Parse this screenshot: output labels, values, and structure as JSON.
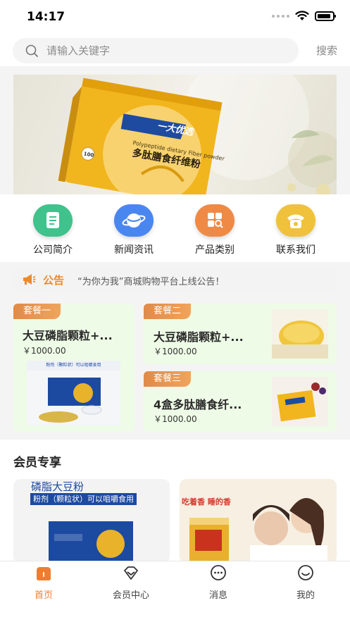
{
  "status_bar": {
    "time": "14:17"
  },
  "search": {
    "placeholder": "请输入关键字",
    "button_label": "搜索"
  },
  "banner": {
    "brand_text": "一大优选",
    "product_en": "Polypeptide dietary Fiber powder",
    "product_cn": "多肽膳食纤维粉",
    "badge": "100"
  },
  "nav": [
    {
      "label": "公司简介",
      "color": "#3fc28b",
      "icon": "document-icon"
    },
    {
      "label": "新闻资讯",
      "color": "#4a86f0",
      "icon": "planet-icon"
    },
    {
      "label": "产品类别",
      "color": "#ef8a46",
      "icon": "grid-search-icon"
    },
    {
      "label": "联系我们",
      "color": "#f0c13a",
      "icon": "phone-icon"
    }
  ],
  "notice": {
    "title": "公告",
    "text": "“为你为我”商城购物平台上线公告！"
  },
  "combos": [
    {
      "tag": "套餐一",
      "name": "大豆磷脂颗粒+...",
      "price": "￥1000.00",
      "image_caption": "粉剂（颗粒状）可以咀嚼食用"
    },
    {
      "tag": "套餐二",
      "name": "大豆磷脂颗粒+...",
      "price": "￥1000.00"
    },
    {
      "tag": "套餐三",
      "name": "4盒多肽膳食纤...",
      "price": "￥1000.00"
    }
  ],
  "member": {
    "title": "会员专享",
    "card1_title": "磷脂大豆粉",
    "card1_subtitle": "粉剂（颗粒状）可以咀嚼食用",
    "card2_slogan": "吃着香 睡的香"
  },
  "tabs": [
    {
      "label": "首页",
      "icon": "home-icon",
      "active": true
    },
    {
      "label": "会员中心",
      "icon": "diamond-icon",
      "active": false
    },
    {
      "label": "消息",
      "icon": "chat-bubble-icon",
      "active": false
    },
    {
      "label": "我的",
      "icon": "smile-icon",
      "active": false
    }
  ],
  "colors": {
    "accent": "#f07d2e",
    "combo_bg": "#eefbe6",
    "tag_orange": "#e8944f"
  }
}
